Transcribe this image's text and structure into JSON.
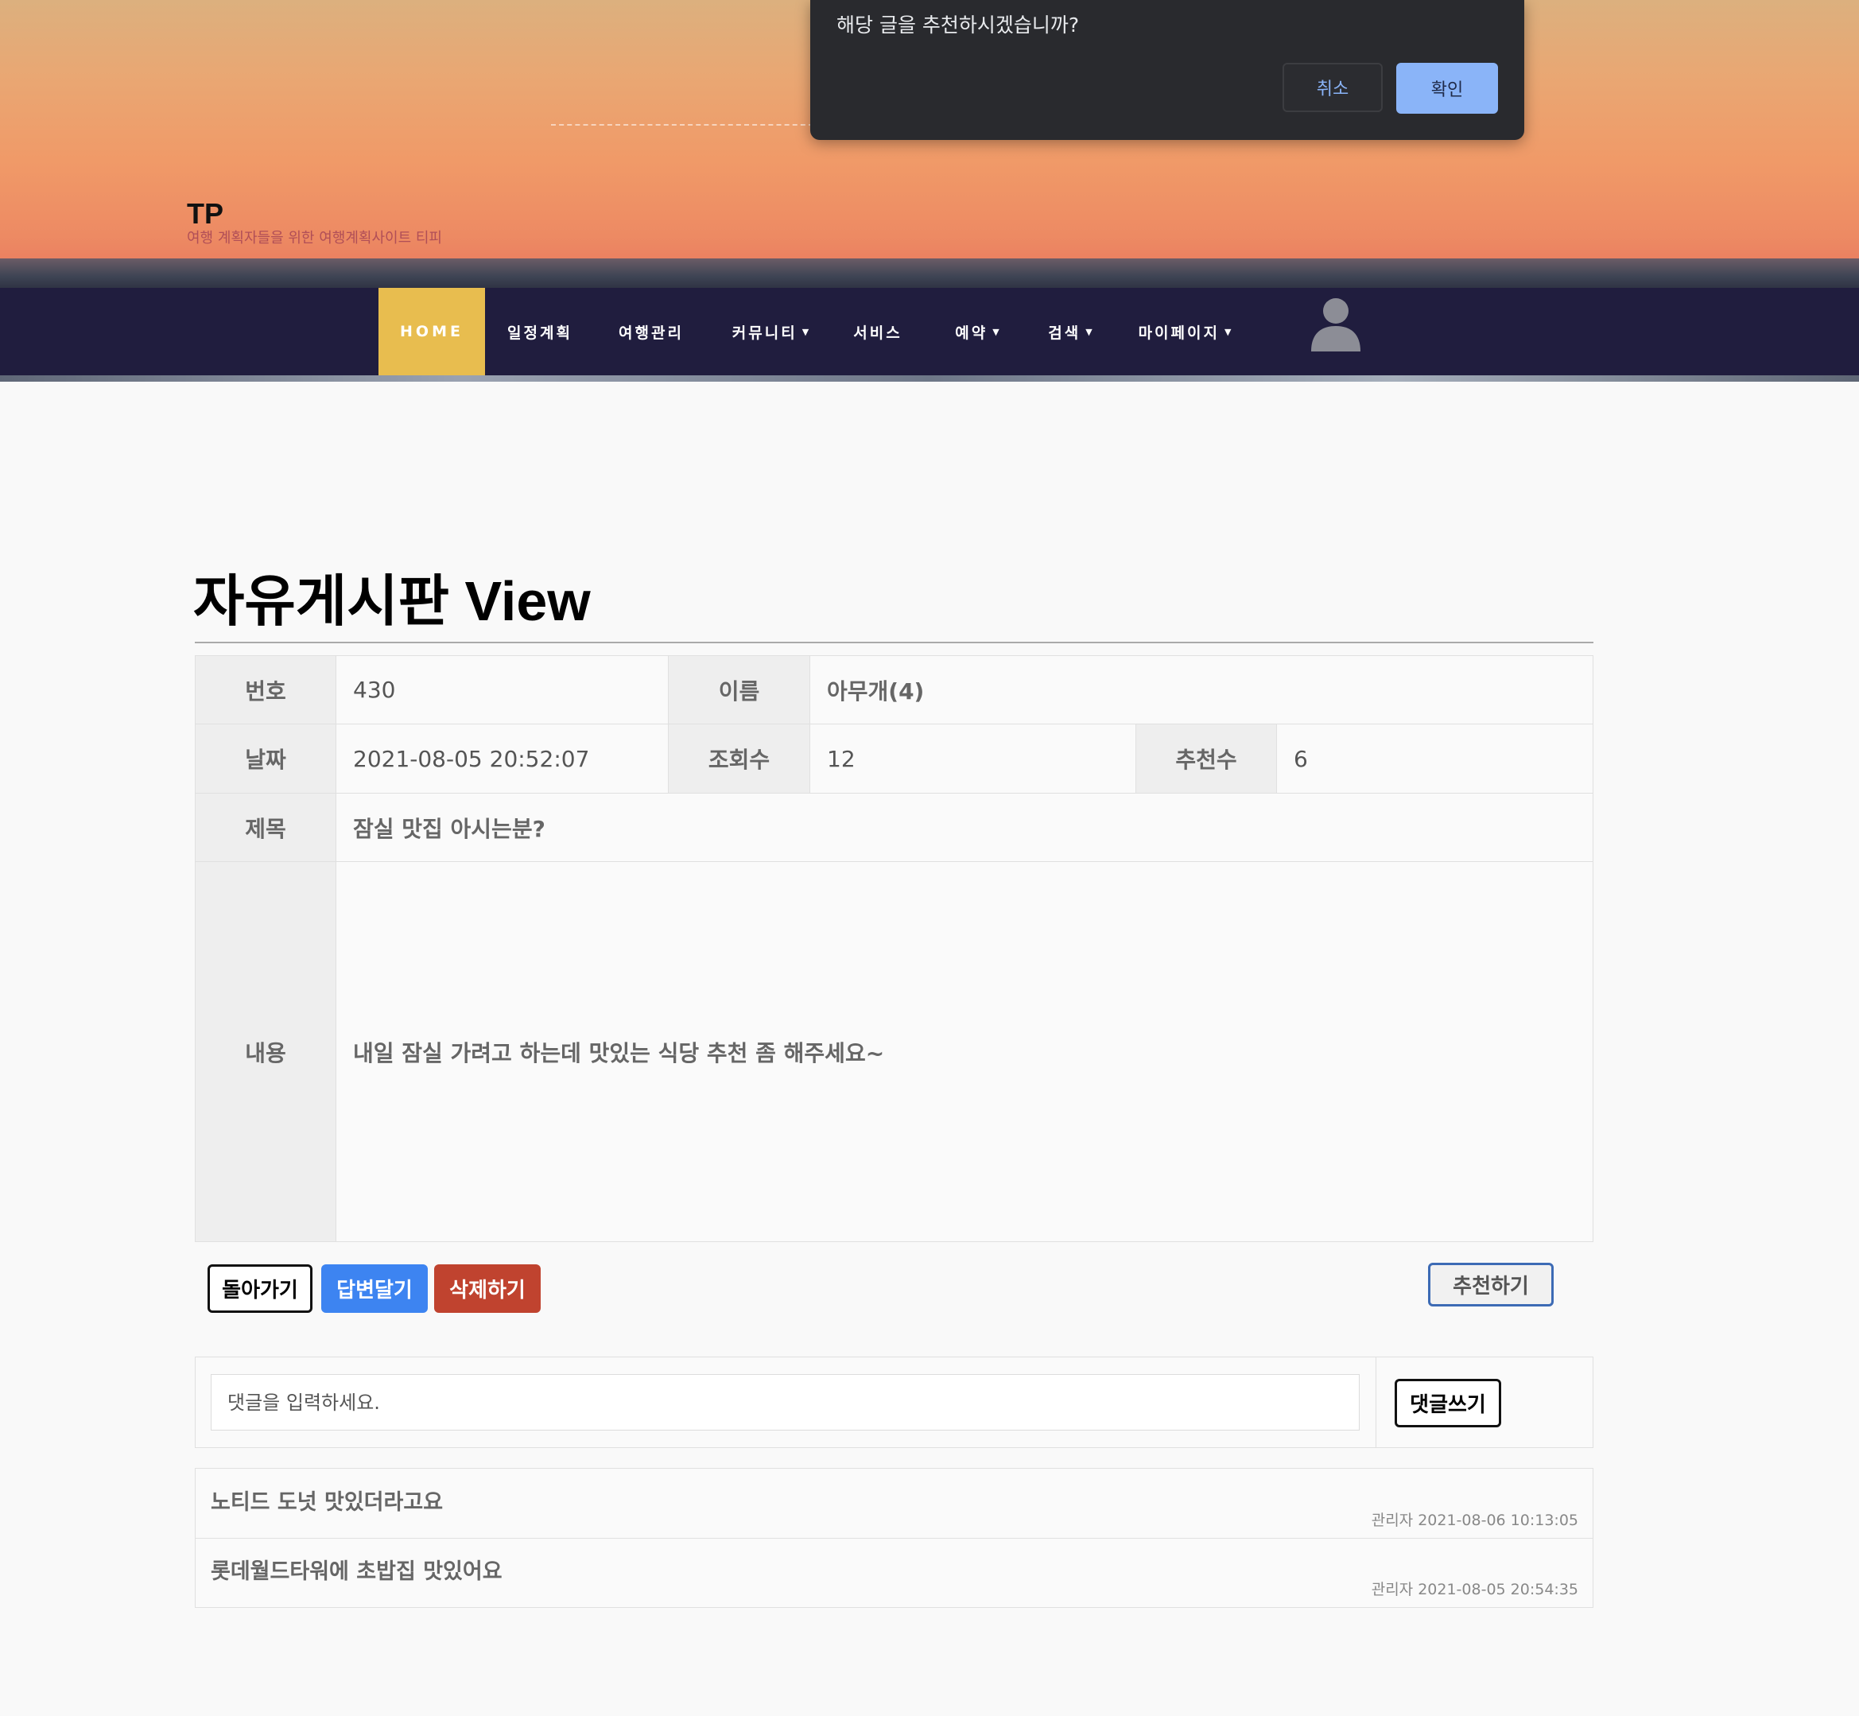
{
  "header": {
    "brand": "TP",
    "tagline": "여행 계획자들을 위한 여행계획사이트 티피"
  },
  "nav": {
    "items": [
      {
        "label": "HOME",
        "active": true
      },
      {
        "label": "일정계획"
      },
      {
        "label": "여행관리"
      },
      {
        "label": "커뮤니티",
        "dropdown": true
      },
      {
        "label": "서비스"
      },
      {
        "label": "예약",
        "dropdown": true
      },
      {
        "label": "검색",
        "dropdown": true
      },
      {
        "label": "마이페이지",
        "dropdown": true
      }
    ],
    "user_icon": "user-icon"
  },
  "dialog": {
    "message": "해당 글을 추천하시겠습니까?",
    "cancel_label": "취소",
    "ok_label": "확인"
  },
  "page": {
    "title": "자유게시판 View"
  },
  "post": {
    "labels": {
      "number": "번호",
      "name": "이름",
      "date": "날짜",
      "views": "조회수",
      "recommends": "추천수",
      "subject": "제목",
      "content": "내용"
    },
    "number": "430",
    "name": "아무개(4)",
    "date": "2021-08-05 20:52:07",
    "views": "12",
    "recommends": "6",
    "subject": "잠실 맛집 아시는분?",
    "content": "내일 잠실 가려고 하는데 맛있는 식당 추천 좀 해주세요~"
  },
  "actions": {
    "back_label": "돌아가기",
    "reply_label": "답변달기",
    "delete_label": "삭제하기",
    "recommend_label": "추천하기"
  },
  "comment_form": {
    "placeholder": "댓글을 입력하세요.",
    "submit_label": "댓글쓰기"
  },
  "comments": [
    {
      "text": "노티드 도넛 맛있더라고요",
      "meta": "관리자 2021-08-06 10:13:05"
    },
    {
      "text": "롯데월드타워에 초밥집 맛있어요",
      "meta": "관리자 2021-08-05 20:54:35"
    }
  ],
  "colors": {
    "nav_bg": "#201d3e",
    "nav_active": "#e8bd4f",
    "reply_button": "#3d84f1",
    "delete_button": "#c0432f",
    "dialog_bg": "#292a2e",
    "dialog_ok": "#8ab4f8"
  }
}
